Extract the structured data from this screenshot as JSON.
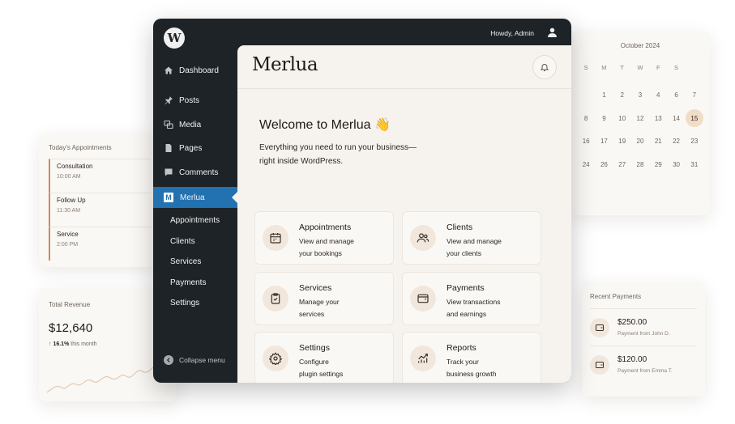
{
  "topbar": {
    "greeting": "Howdy, Admin"
  },
  "sidebar": {
    "items": [
      {
        "label": "Dashboard",
        "icon": "home-icon"
      },
      {
        "label": "Posts",
        "icon": "pin-icon"
      },
      {
        "label": "Media",
        "icon": "media-icon"
      },
      {
        "label": "Pages",
        "icon": "pages-icon"
      },
      {
        "label": "Comments",
        "icon": "comments-icon"
      },
      {
        "label": "Merlua",
        "icon": "merlua-icon",
        "active": true
      }
    ],
    "submenu": [
      "Appointments",
      "Clients",
      "Services",
      "Payments",
      "Settings"
    ],
    "collapse_label": "Collapse menu"
  },
  "content": {
    "brand": "Merlua",
    "welcome_title": "Welcome to Merlua 👋",
    "tagline_line1": "Everything you need to run your business—",
    "tagline_line2": "right inside WordPress.",
    "tiles": [
      {
        "title": "Appointments",
        "line1": "View and manage",
        "line2": "your bookings",
        "icon": "calendar-icon"
      },
      {
        "title": "Clients",
        "line1": "View and manage",
        "line2": "your clients",
        "icon": "users-icon"
      },
      {
        "title": "Services",
        "line1": "Manage your",
        "line2": "services",
        "icon": "clipboard-check-icon"
      },
      {
        "title": "Payments",
        "line1": "View transactions",
        "line2": "and earnings",
        "icon": "wallet-icon"
      },
      {
        "title": "Settings",
        "line1": "Configure",
        "line2": "plugin settings",
        "icon": "gear-icon"
      },
      {
        "title": "Reports",
        "line1": "Track your",
        "line2": "business growth",
        "icon": "growth-chart-icon"
      }
    ]
  },
  "appointments_card": {
    "title": "Today's Appointments",
    "items": [
      {
        "name": "Consultation",
        "time": "10:00 AM"
      },
      {
        "name": "Follow Up",
        "time": "11:30 AM"
      },
      {
        "name": "Service",
        "time": "2:00 PM"
      }
    ]
  },
  "revenue_card": {
    "title": "Total Revenue",
    "amount": "$12,640",
    "change": "16.1%",
    "change_suffix": "this month"
  },
  "calendar_card": {
    "month": "October 2024",
    "weekdays": [
      "S",
      "M",
      "T",
      "W",
      "F",
      "S"
    ],
    "weeks": [
      [
        "",
        "",
        "1",
        "2",
        "3",
        "4"
      ],
      [
        "6",
        "7",
        "8",
        "9",
        "10",
        "12"
      ],
      [
        "13",
        "14",
        "15",
        "16",
        "17",
        "19"
      ],
      [
        "20",
        "21",
        "22",
        "23",
        "24",
        "26"
      ],
      [
        "27",
        "28",
        "29",
        "30",
        "31",
        ""
      ]
    ],
    "today": "15"
  },
  "payments_card": {
    "title": "Recent Payments",
    "items": [
      {
        "amount": "$250.00",
        "from": "Payment from John D."
      },
      {
        "amount": "$120.00",
        "from": "Payment from Emma T."
      }
    ]
  },
  "colors": {
    "wp_admin_bg": "#1d2327",
    "active_blue": "#2271b1",
    "accent": "#c98b5f",
    "cream": "#f6f3ef"
  }
}
